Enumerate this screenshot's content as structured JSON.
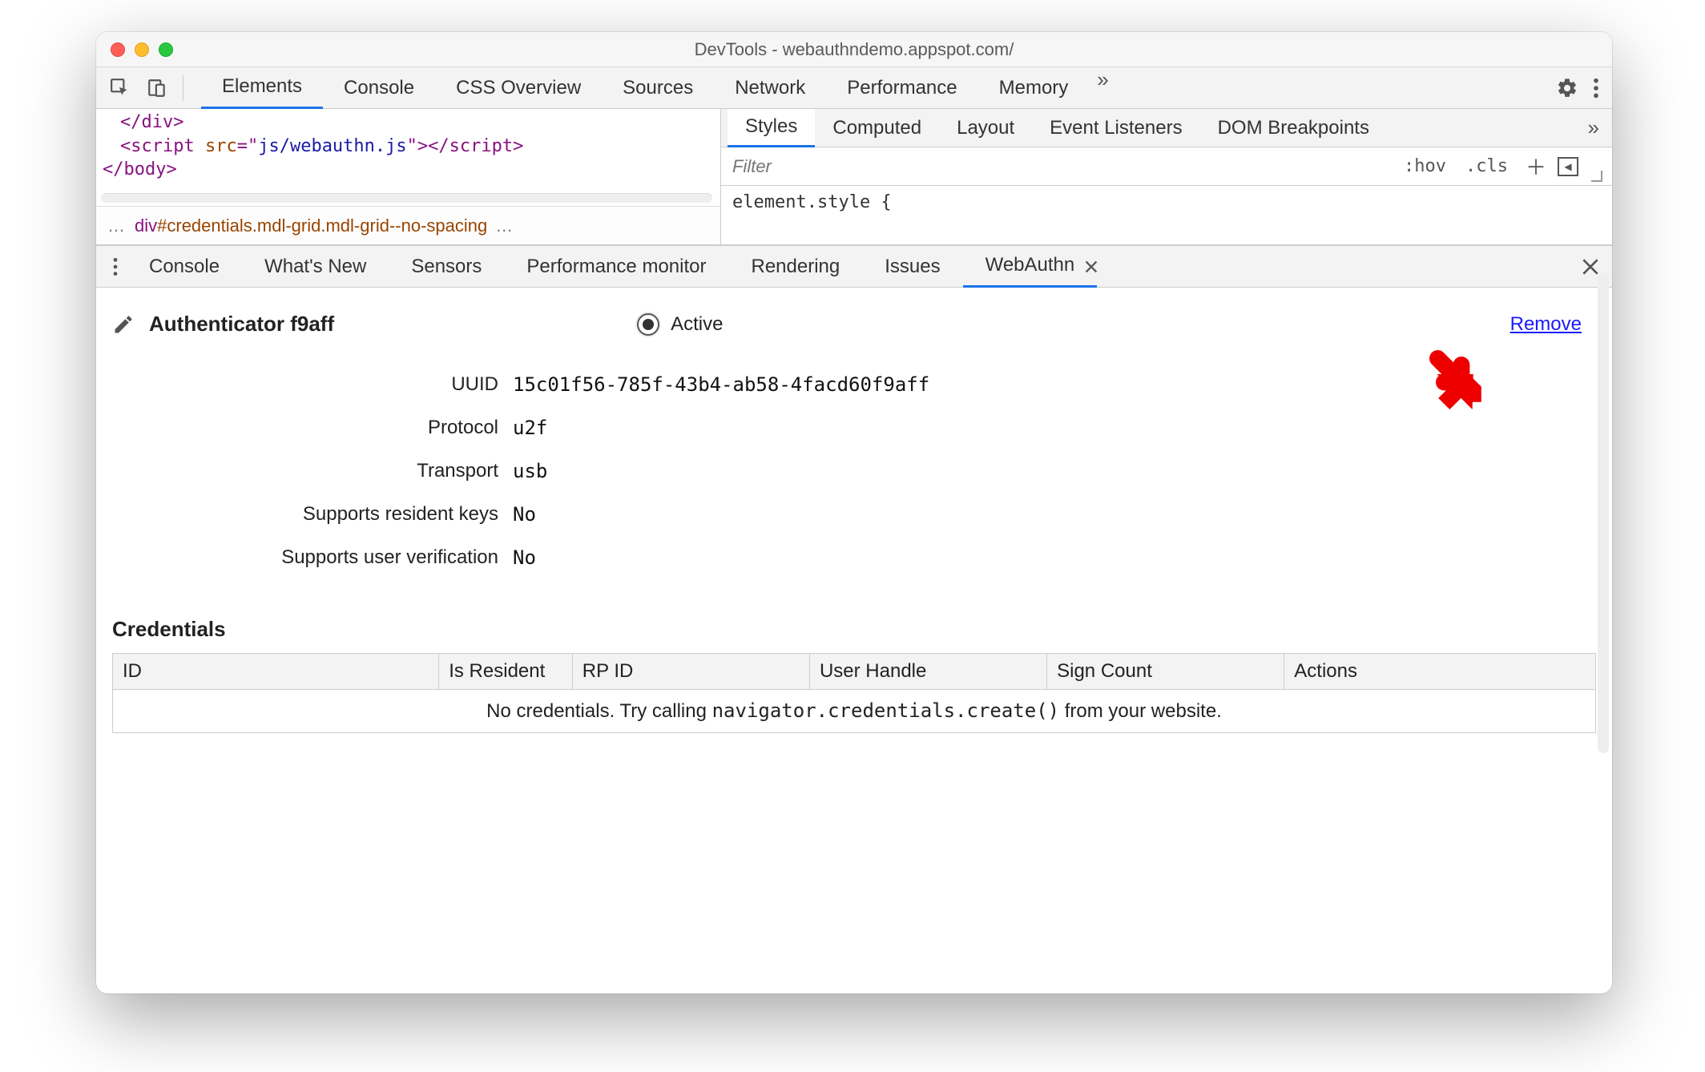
{
  "window_title": "DevTools - webauthndemo.appspot.com/",
  "main_tabs": {
    "items": [
      "Elements",
      "Console",
      "CSS Overview",
      "Sources",
      "Network",
      "Performance",
      "Memory"
    ],
    "selected": "Elements",
    "overflow": "»"
  },
  "source_html": {
    "line1_tag": "</div>",
    "line2_open": "<script ",
    "line2_attr": "src",
    "line2_eq": "=\"",
    "line2_val": "js/webauthn.js",
    "line2_close": "\"></scr",
    "line2_close2": "ipt>",
    "line3": "</body>"
  },
  "breadcrumb": {
    "prefix_dots": "…",
    "tag": "div",
    "id_hash": "#",
    "id": "credentials",
    "cls_dot": ".",
    "cls1": "mdl-grid",
    "cls_dot2": ".",
    "cls2": "mdl-grid--no-spacing",
    "suffix_dots": "…"
  },
  "styles_tabs": {
    "items": [
      "Styles",
      "Computed",
      "Layout",
      "Event Listeners",
      "DOM Breakpoints"
    ],
    "selected": "Styles",
    "overflow": "»"
  },
  "filter": {
    "placeholder": "Filter",
    "hov": ":hov",
    "cls": ".cls"
  },
  "style_code": "element.style {",
  "drawer_tabs": {
    "items": [
      "Console",
      "What's New",
      "Sensors",
      "Performance monitor",
      "Rendering",
      "Issues",
      "WebAuthn"
    ],
    "selected": "WebAuthn"
  },
  "authenticator": {
    "title": "Authenticator f9aff",
    "active_label": "Active",
    "remove": "Remove",
    "rows": {
      "uuid_k": "UUID",
      "uuid_v": "15c01f56-785f-43b4-ab58-4facd60f9aff",
      "proto_k": "Protocol",
      "proto_v": "u2f",
      "trans_k": "Transport",
      "trans_v": "usb",
      "rk_k": "Supports resident keys",
      "rk_v": "No",
      "uv_k": "Supports user verification",
      "uv_v": "No"
    }
  },
  "credentials": {
    "heading": "Credentials",
    "columns": [
      "ID",
      "Is Resident",
      "RP ID",
      "User Handle",
      "Sign Count",
      "Actions"
    ],
    "empty_pre": "No credentials. Try calling ",
    "empty_mono": "navigator.credentials.create()",
    "empty_post": " from your website."
  },
  "colors": {
    "accent": "#1a73e8",
    "arrow": "#ef0000",
    "link": "#1a1aff"
  }
}
